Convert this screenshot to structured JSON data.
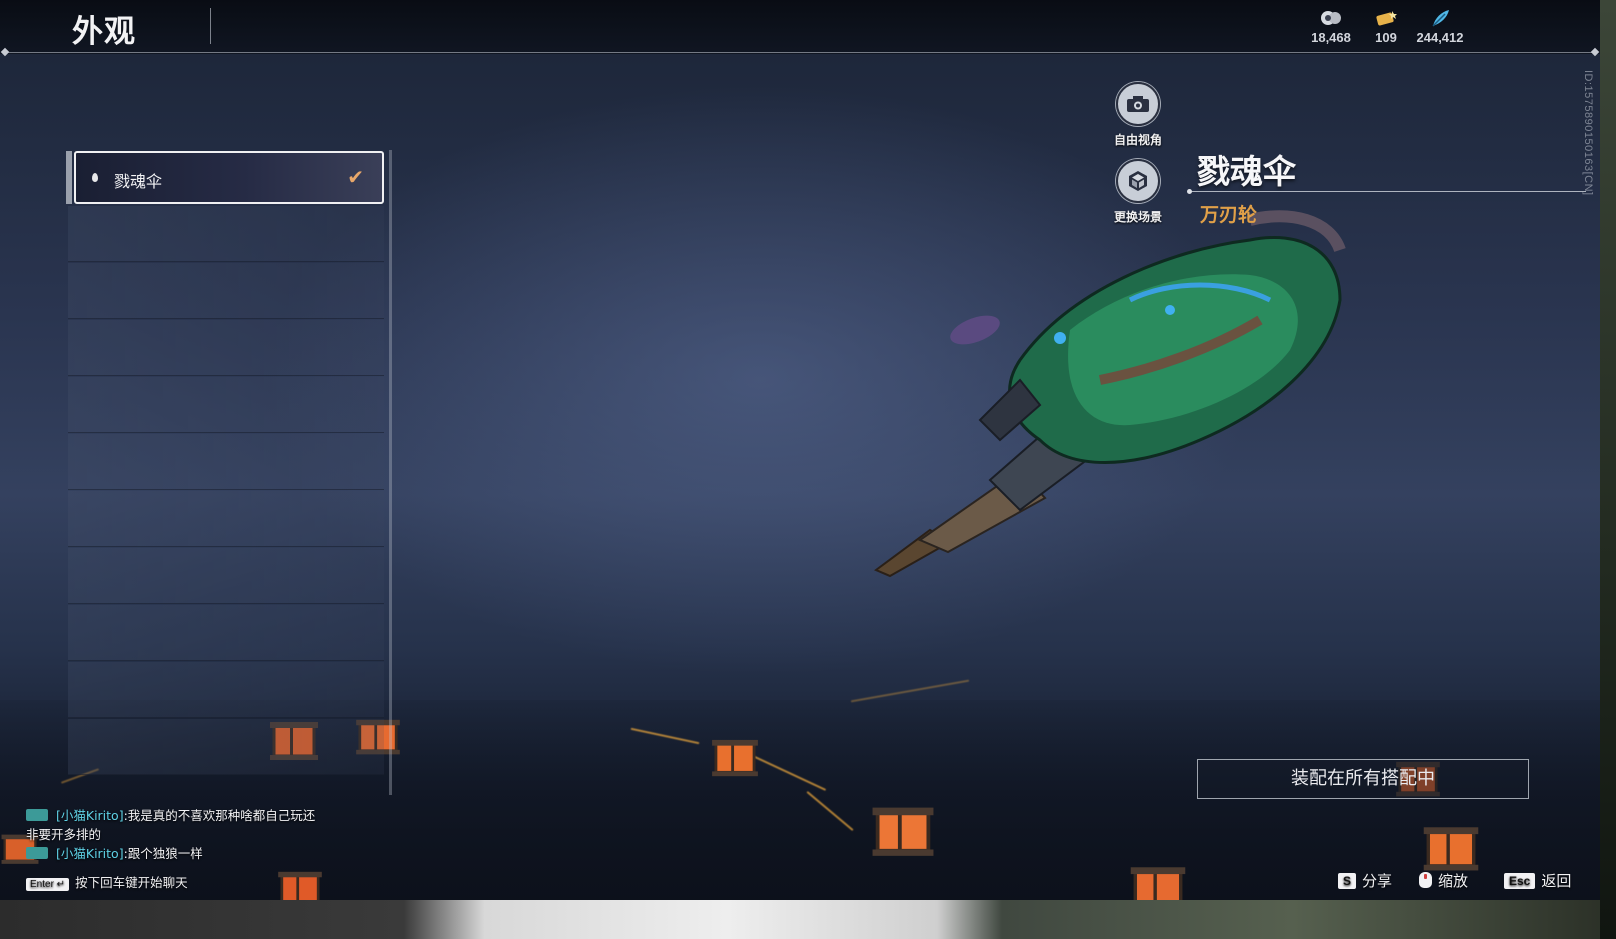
{
  "page": {
    "title": "外观"
  },
  "currencies": [
    {
      "icon": "gem-coin-icon",
      "value": "18,468",
      "color": "#cfd3da"
    },
    {
      "icon": "ticket-icon",
      "value": "109",
      "color": "#e7b24a"
    },
    {
      "icon": "feather-icon",
      "value": "244,412",
      "color": "#4fb7e6"
    }
  ],
  "list": {
    "items": [
      {
        "label": "戮魂伞",
        "selected": true
      }
    ]
  },
  "actions": {
    "free_view": "自由视角",
    "change_scene": "更换场景"
  },
  "item": {
    "name": "戮魂伞",
    "category": "万刃轮",
    "id_text": "ID:1575890150163[CN]"
  },
  "equip_button": "装配在所有搭配中",
  "chat": {
    "messages": [
      {
        "name": "[小猫Kirito]",
        "text": ":我是真的不喜欢那种啥都自己玩还非要开多排的"
      },
      {
        "name": "[小猫Kirito]",
        "text": ":跟个独狼一样"
      }
    ],
    "enter_key": "Enter",
    "hint": "按下回车键开始聊天"
  },
  "hotkeys": {
    "share_key": "S",
    "share_label": "分享",
    "zoom_label": "缩放",
    "back_key": "Esc",
    "back_label": "返回"
  },
  "colors": {
    "accent_gold": "#e0a048",
    "check": "#e8a76a",
    "chat_name": "#5fd2e6"
  }
}
